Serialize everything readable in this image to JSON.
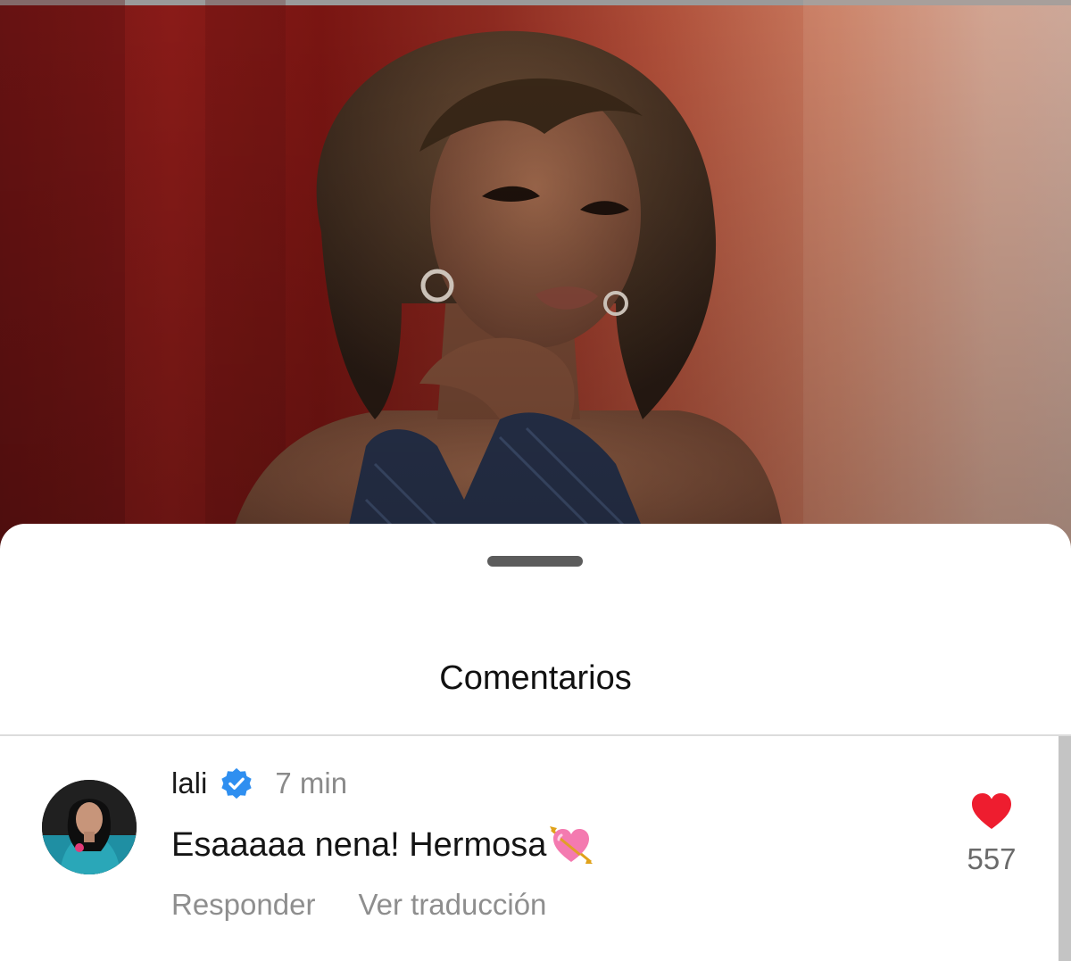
{
  "post": {
    "image_icon": "post-photo"
  },
  "comments_sheet": {
    "title": "Comentarios",
    "grabber_icon": "drag-handle-icon"
  },
  "comment": {
    "username": "lali",
    "verified_icon": "verified-badge-icon",
    "time": "7 min",
    "text": "Esaaaaa nena! Hermosa",
    "emoji_icon": "heart-with-arrow-emoji",
    "reply_label": "Responder",
    "translate_label": "Ver traducción",
    "like_icon": "heart-icon",
    "like_count": "557",
    "like_color": "#ee1d2f",
    "verified_color": "#2f8ff0"
  }
}
